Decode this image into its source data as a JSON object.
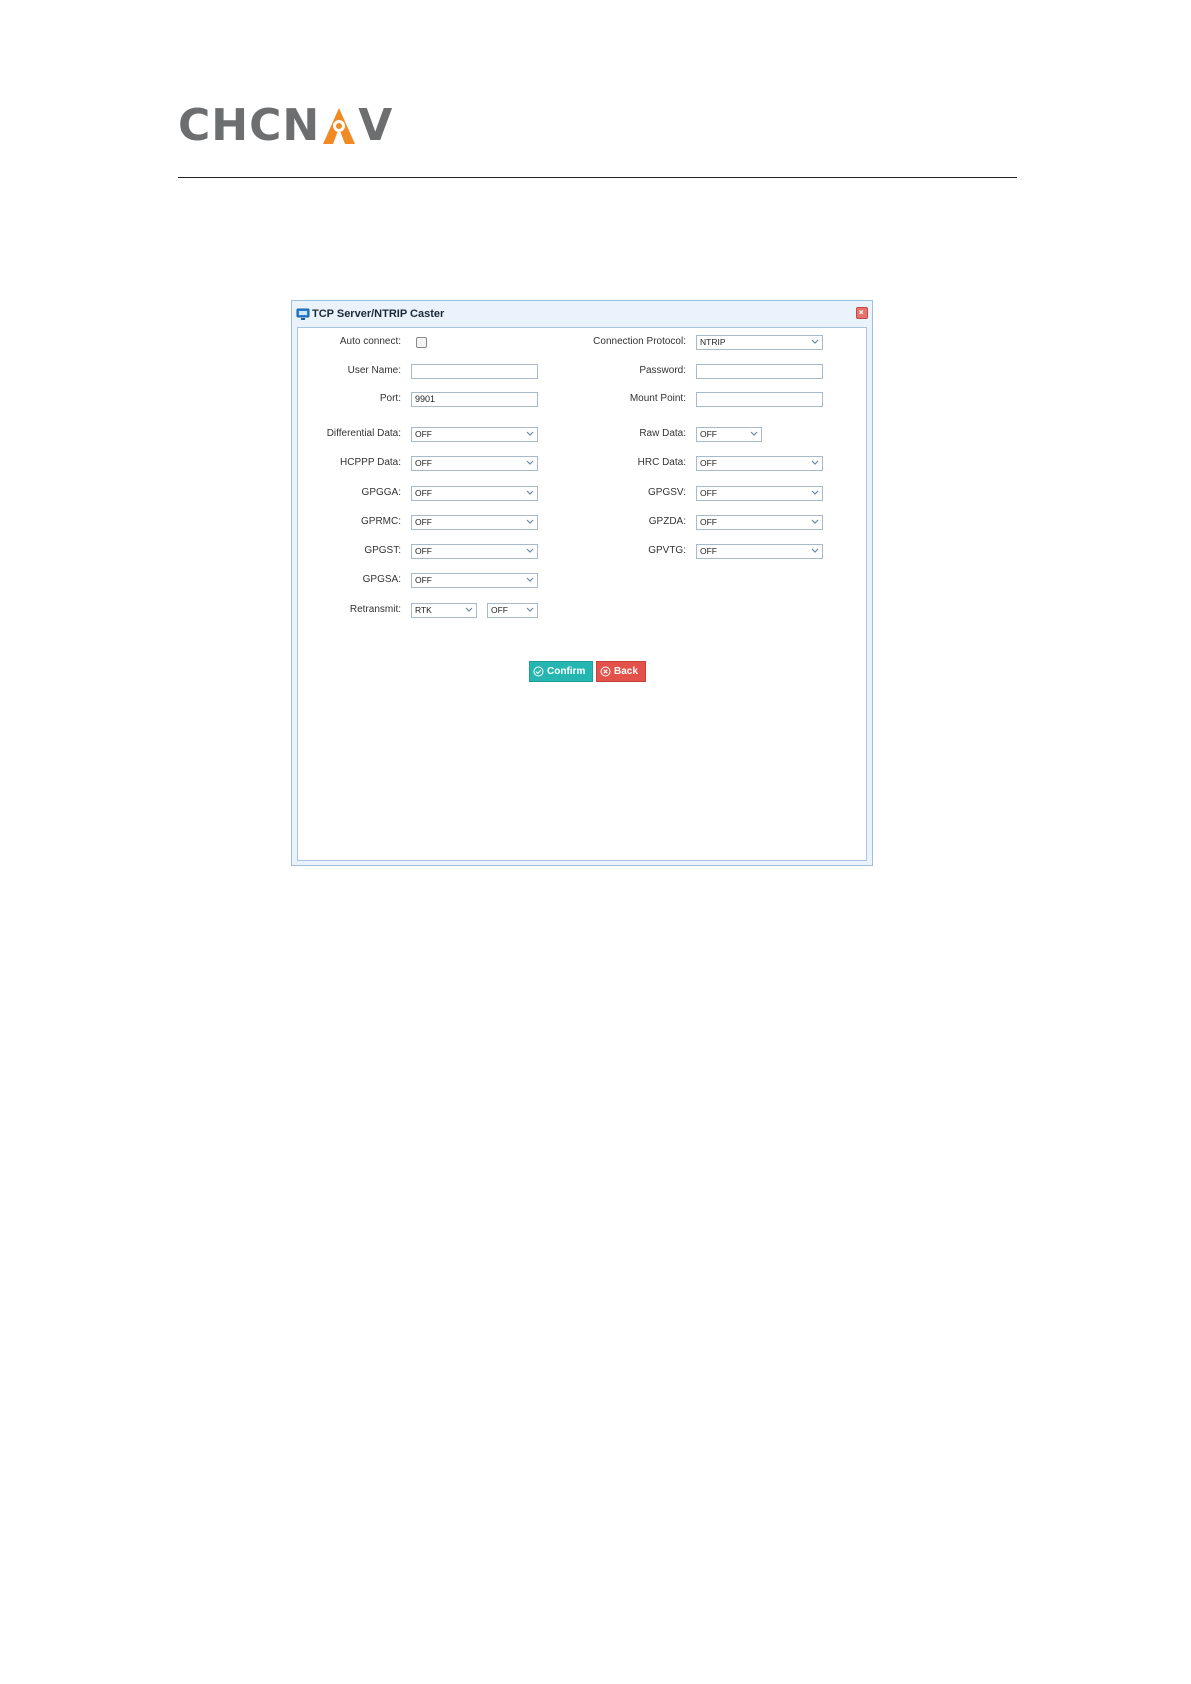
{
  "header": {
    "logo_left": "CHCN",
    "logo_right": "V",
    "brand_gray": "#6d6e70",
    "brand_orange": "#f08a24"
  },
  "dialog": {
    "title": "TCP Server/NTRIP Caster",
    "title_icon": "monitor-icon",
    "close_icon": "close-icon"
  },
  "form": {
    "auto_connect_label": "Auto connect:",
    "auto_connect_checked": false,
    "connection_protocol_label": "Connection Protocol:",
    "connection_protocol_value": "NTRIP",
    "user_name_label": "User Name:",
    "user_name_value": "",
    "password_label": "Password:",
    "password_value": "",
    "port_label": "Port:",
    "port_value": "9901",
    "mount_point_label": "Mount Point:",
    "mount_point_value": "",
    "differential_data_label": "Differential Data:",
    "differential_data_value": "OFF",
    "raw_data_label": "Raw Data:",
    "raw_data_value": "OFF",
    "hcppp_data_label": "HCPPP Data:",
    "hcppp_data_value": "OFF",
    "hrc_data_label": "HRC Data:",
    "hrc_data_value": "OFF",
    "gpgga_label": "GPGGA:",
    "gpgga_value": "OFF",
    "gpgsv_label": "GPGSV:",
    "gpgsv_value": "OFF",
    "gprmc_label": "GPRMC:",
    "gprmc_value": "OFF",
    "gpzda_label": "GPZDA:",
    "gpzda_value": "OFF",
    "gpgst_label": "GPGST:",
    "gpgst_value": "OFF",
    "gpvtg_label": "GPVTG:",
    "gpvtg_value": "OFF",
    "gpgsa_label": "GPGSA:",
    "gpgsa_value": "OFF",
    "retransmit_label": "Retransmit:",
    "retransmit_source_value": "RTK",
    "retransmit_state_value": "OFF"
  },
  "buttons": {
    "confirm_label": "Confirm",
    "back_label": "Back",
    "confirm_color": "#25b6b1",
    "back_color": "#e2524b"
  }
}
